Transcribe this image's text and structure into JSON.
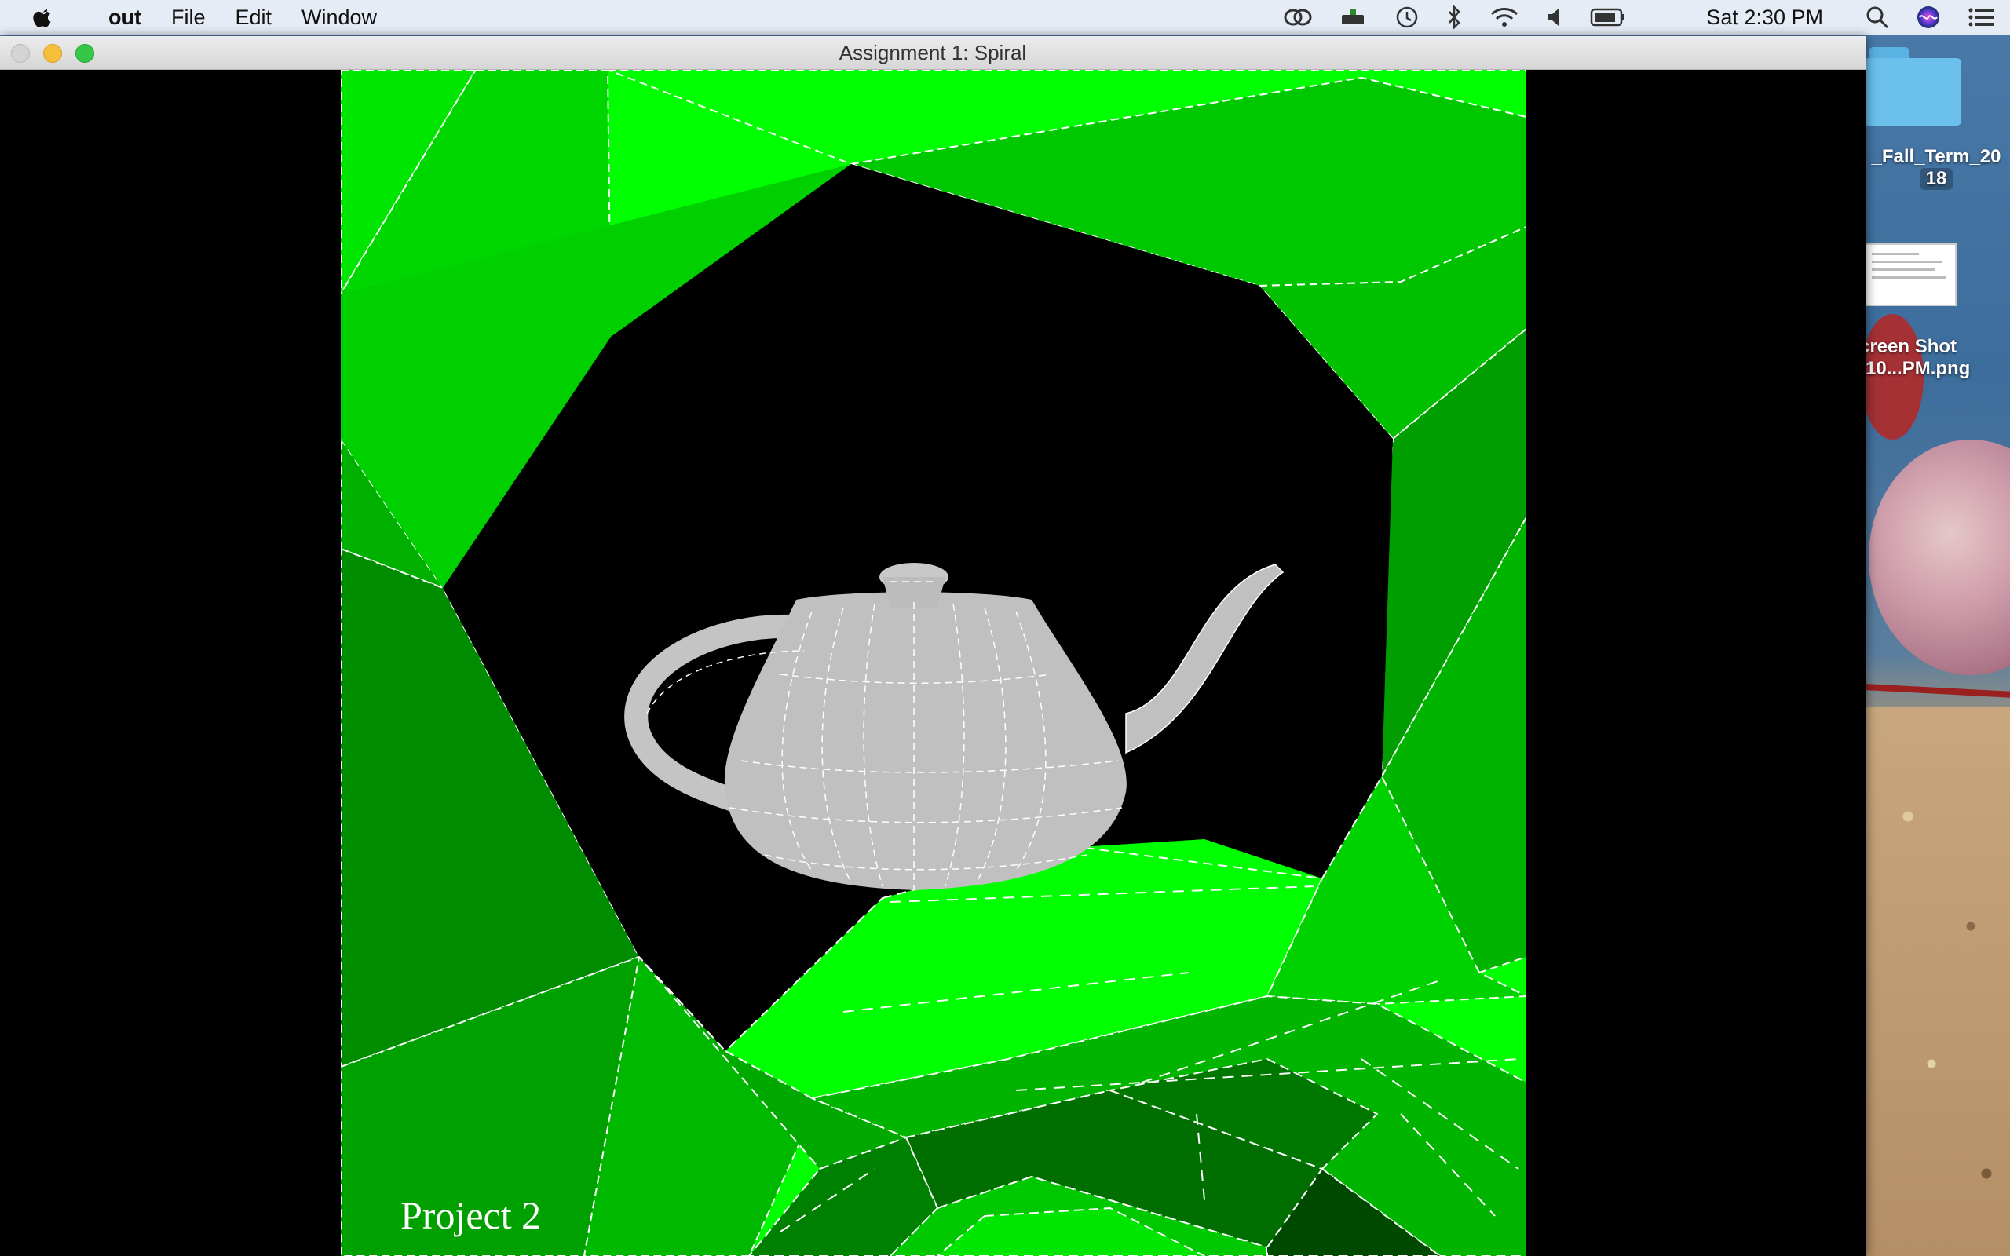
{
  "menubar": {
    "app_name": "out",
    "menus": [
      "File",
      "Edit",
      "Window"
    ],
    "clock": "Sat 2:30 PM",
    "status_icons": [
      "creative-cloud-icon",
      "usb-drive-icon",
      "time-machine-icon",
      "bluetooth-icon",
      "wifi-icon",
      "volume-icon",
      "battery-icon",
      "french-flag-icon",
      "spotlight-search-icon",
      "siri-icon",
      "notification-center-icon"
    ]
  },
  "window": {
    "title": "Assignment 1: Spiral",
    "overlay_text": "Project 2"
  },
  "desktop": {
    "folder_label_line1": "_Fall_Term_20",
    "folder_label_line2": "18",
    "file_label_line1": "creen Shot",
    "file_label_line2": "-10...PM.png"
  },
  "colors": {
    "bright_green": "#00ff00",
    "mid_green": "#00c800",
    "dark_green": "#009600",
    "teapot": "#c0c0c0",
    "wire": "#ffffff"
  }
}
